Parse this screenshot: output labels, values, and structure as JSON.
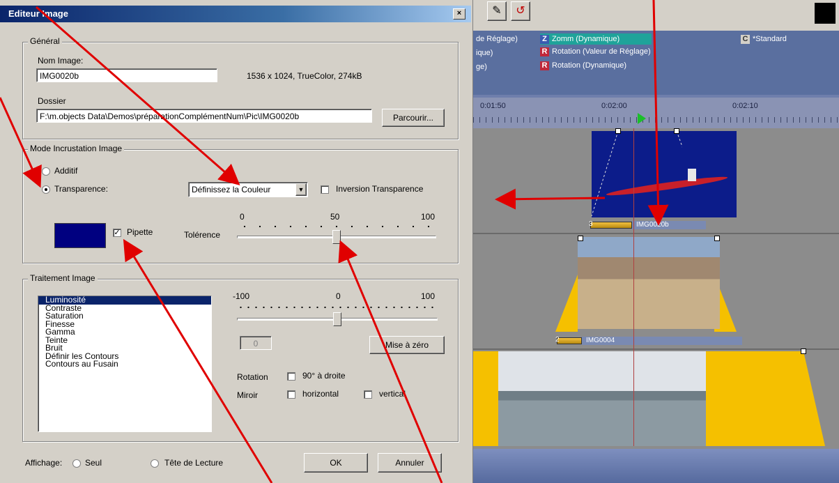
{
  "dialog": {
    "title": "Editeur Image",
    "close_label": "×",
    "general": {
      "legend": "Général",
      "name_label": "Nom Image:",
      "name_value": "IMG0020b",
      "info": "1536 x 1024, TrueColor, 274kB",
      "folder_label": "Dossier",
      "folder_value": "F:\\m.objects Data\\Demos\\préparationComplémentNum\\Pic\\IMG0020b",
      "browse_label": "Parcourir..."
    },
    "mode": {
      "legend": "Mode Incrustation Image",
      "additive_label": "Additif",
      "transparency_label": "Transparence:",
      "color_select_value": "Définissez la Couleur",
      "invert_label": "Inversion Transparence",
      "color_swatch": "#000080",
      "pipette_label": "Pipette",
      "pipette_checked": "✓",
      "tolerance_label": "Tolérence",
      "tolerance_ticks": [
        "0",
        "50",
        "100"
      ],
      "tolerance_value": 50
    },
    "processing": {
      "legend": "Traitement Image",
      "items": [
        "Luminosité",
        "Contraste",
        "Saturation",
        "Finesse",
        "Gamma",
        "Teinte",
        "Bruit",
        "Définir les Contours",
        "Contours au Fusain"
      ],
      "selected_index": 0,
      "slider_ticks": [
        "-100",
        "0",
        "100"
      ],
      "slider_value": 0,
      "value_field": "0",
      "reset_label": "Mise à zéro",
      "rotation_label": "Rotation",
      "rotation_option": "90° à droite",
      "mirror_label": "Miroir",
      "mirror_h": "horizontal",
      "mirror_v": "vertical"
    },
    "footer": {
      "display_label": "Affichage:",
      "alone_label": "Seul",
      "playhead_label": "Tête de Lecture",
      "ok_label": "OK",
      "cancel_label": "Annuler"
    }
  },
  "right_panel": {
    "fx_rows": [
      {
        "left": "de Réglage)",
        "badge": "Z",
        "name": "Zomm (Dynamique)",
        "extra_badge": "C",
        "extra": "*Standard"
      },
      {
        "left": "ique)",
        "badge": "R",
        "name": "Rotation (Valeur de Réglage)"
      },
      {
        "left": "ge)",
        "badge": "R",
        "name": "Rotation (Dynamique)"
      }
    ],
    "ruler_labels": [
      "0:01:50",
      "0:02:00",
      "0:02:10"
    ],
    "clips": [
      {
        "number": "3",
        "name": "IMG0020b"
      },
      {
        "number": "2",
        "name": "IMG0004"
      }
    ]
  },
  "colors": {
    "selection": "#0a246a",
    "annotation_arrow": "#e00000",
    "clip_yellow": "#f5c000"
  }
}
